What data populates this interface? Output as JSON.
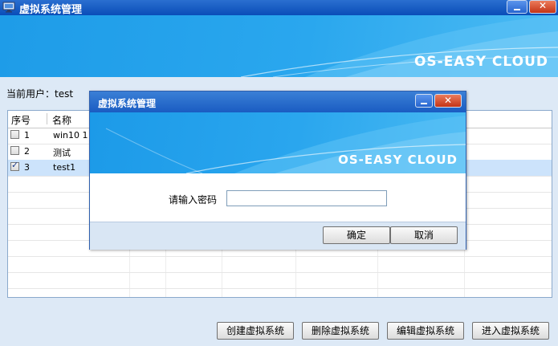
{
  "window": {
    "title": "虚拟系统管理",
    "close_label": "✕",
    "brand": "OS-EASY CLOUD"
  },
  "current_user": {
    "label": "当前用户：test"
  },
  "grid": {
    "columns": [
      "序号",
      "名称"
    ],
    "rows": [
      {
        "num": "1",
        "name": "win10 1",
        "checked": false,
        "selected": false
      },
      {
        "num": "2",
        "name": "测试",
        "checked": false,
        "selected": false
      },
      {
        "num": "3",
        "name": "test1",
        "checked": true,
        "selected": true
      }
    ]
  },
  "actions": {
    "create": "创建虚拟系统",
    "delete": "删除虚拟系统",
    "edit": "编辑虚拟系统",
    "enter": "进入虚拟系统"
  },
  "dialog": {
    "title": "虚拟系统管理",
    "close_label": "✕",
    "brand": "OS-EASY CLOUD",
    "password_label": "请输入密码",
    "password_value": "",
    "ok": "确定",
    "cancel": "取消"
  },
  "colors": {
    "titlebar": "#0a4db8",
    "banner": "#2aa7ee",
    "selection": "#cce3fb"
  }
}
